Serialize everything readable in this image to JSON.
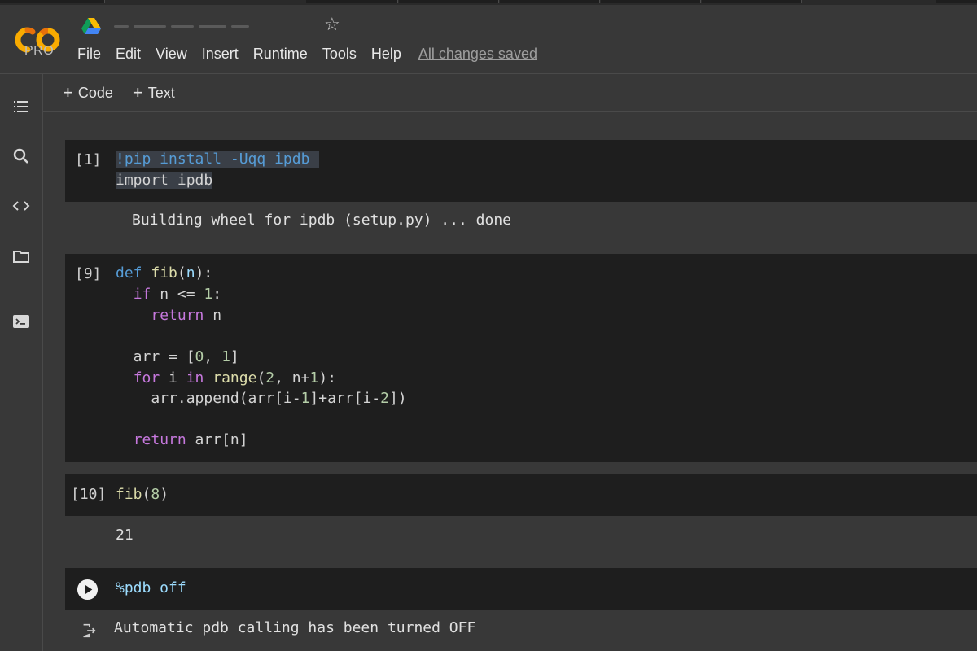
{
  "app": {
    "logo_text": "CO",
    "pro_label": "PRO",
    "save_status": "All changes saved"
  },
  "menu": [
    "File",
    "Edit",
    "View",
    "Insert",
    "Runtime",
    "Tools",
    "Help"
  ],
  "toolbar": {
    "add_code": "Code",
    "add_text": "Text"
  },
  "icons": {
    "star": "star-icon",
    "toc": "table-of-contents-icon",
    "search": "search-icon",
    "snippets": "code-snippets-icon",
    "files": "folder-icon",
    "terminal": "terminal-icon",
    "run": "run-cell-icon",
    "output": "output-icon",
    "drive": "google-drive-icon"
  },
  "colors": {
    "logo_orange": "#f9ab00",
    "logo_dark_orange": "#e8710a",
    "background": "#383838",
    "cell_background": "#1e1e1e"
  },
  "cells": [
    {
      "exec": "[1]",
      "code": [
        "!pip install -Uqq ipdb",
        "import ipdb"
      ],
      "output": "Building wheel for ipdb (setup.py) ... done"
    },
    {
      "exec": "[9]",
      "code": [
        "def fib(n):",
        "  if n <= 1:",
        "    return n",
        "",
        "  arr = [0, 1]",
        "  for i in range(2, n+1):",
        "    arr.append(arr[i-1]+arr[i-2])",
        "",
        "  return arr[n]"
      ]
    },
    {
      "exec": "[10]",
      "code": [
        "fib(8)"
      ],
      "output": "21"
    },
    {
      "exec": "",
      "code": [
        "%pdb off"
      ],
      "output": "Automatic pdb calling has been turned OFF"
    }
  ]
}
